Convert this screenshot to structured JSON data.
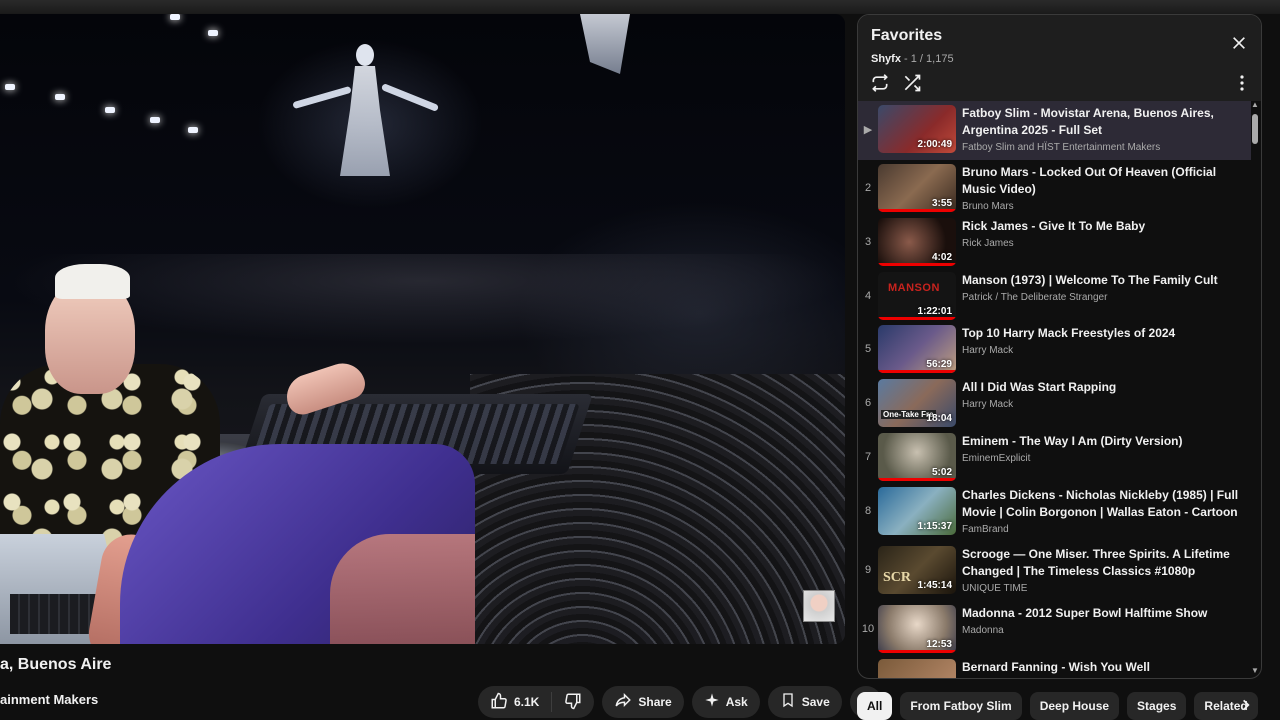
{
  "video": {
    "title_fragment": "a, Buenos Aire",
    "channel_fragment": "ainment Makers"
  },
  "actions": {
    "like_count": "6.1K",
    "share_label": "Share",
    "ask_label": "Ask",
    "save_label": "Save"
  },
  "chips": [
    "All",
    "From Fatboy Slim",
    "Deep House",
    "Stages",
    "Related"
  ],
  "playlist": {
    "title": "Favorites",
    "owner": "Shyfx",
    "position": " - 1 / 1,175",
    "items": [
      {
        "index": "▶",
        "title": "Fatboy Slim - Movistar Arena, Buenos Aires, Argentina 2025 - Full Set",
        "channel": "Fatboy Slim and HÏST Entertainment Makers",
        "duration": "2:00:49",
        "thumb_color": "#6b2a2a"
      },
      {
        "index": "2",
        "title": "Bruno Mars - Locked Out Of Heaven (Official Music Video)",
        "channel": "Bruno Mars",
        "duration": "3:55",
        "thumb_color": "#6a4a3a"
      },
      {
        "index": "3",
        "title": "Rick James - Give It To Me Baby",
        "channel": "Rick James",
        "duration": "4:02",
        "thumb_color": "#2a1a18"
      },
      {
        "index": "4",
        "title": "Manson (1973) | Welcome To The Family Cult",
        "channel": "Patrick / The Deliberate Stranger",
        "duration": "1:22:01",
        "thumb_color": "#161616"
      },
      {
        "index": "5",
        "title": "Top 10 Harry Mack Freestyles of 2024",
        "channel": "Harry Mack",
        "duration": "56:29",
        "thumb_color": "#3a4a7a"
      },
      {
        "index": "6",
        "title": "All I Did Was Start Rapping",
        "channel": "Harry Mack",
        "duration": "18:04",
        "thumb_color": "#5a6a8a"
      },
      {
        "index": "7",
        "title": "Eminem - The Way I Am (Dirty Version)",
        "channel": "EminemExplicit",
        "duration": "5:02",
        "thumb_color": "#6a6a5a"
      },
      {
        "index": "8",
        "title": "Charles Dickens - Nicholas Nickleby (1985) | Full Movie | Colin Borgonon | Wallas Eaton - Cartoon",
        "channel": "FamBrand",
        "duration": "1:15:37",
        "thumb_color": "#3a6a8a"
      },
      {
        "index": "9",
        "title": "Scrooge — One Miser. Three Spirits. A Lifetime Changed | The Timeless Classics #1080p",
        "channel": "UNIQUE TIME",
        "duration": "1:45:14",
        "thumb_color": "#3a3020"
      },
      {
        "index": "10",
        "title": "Madonna - 2012 Super Bowl Halftime Show",
        "channel": "Madonna",
        "duration": "12:53",
        "thumb_color": "#8a7a6a"
      },
      {
        "index": "",
        "title": "Bernard Fanning - Wish You Well",
        "channel": "",
        "duration": "",
        "thumb_color": "#7a5a3a"
      }
    ],
    "thumb_text_4": "MANSON",
    "thumb_text_6": "One-Take Fre",
    "thumb_text_9": "SCR"
  },
  "colors": {
    "background": "#0f0f0f",
    "current_row": "#2d2a36",
    "progress": "#ee0000"
  }
}
